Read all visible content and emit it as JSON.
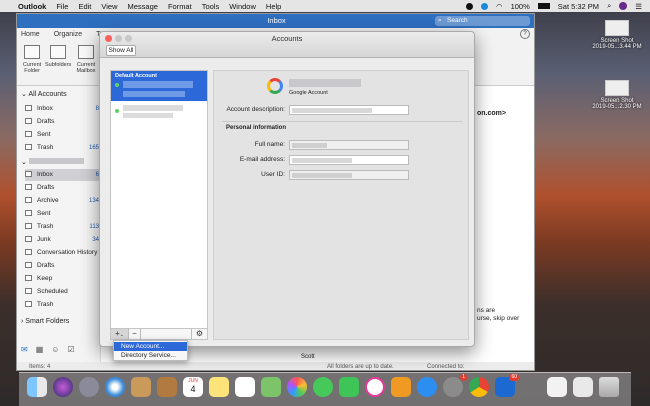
{
  "menubar": {
    "app": "Outlook",
    "items": [
      "File",
      "Edit",
      "View",
      "Message",
      "Format",
      "Tools",
      "Window",
      "Help"
    ],
    "battery": "100%",
    "time": "Sat 5:32 PM"
  },
  "outlook": {
    "title": "Inbox",
    "search_placeholder": "Search",
    "tabs": [
      "Home",
      "Organize",
      "To"
    ],
    "ribbon": [
      "Current Folder",
      "Subfolders",
      "Current Mailbox"
    ],
    "all_accounts": "All Accounts",
    "folders_top": [
      {
        "name": "Inbox",
        "count": "8"
      },
      {
        "name": "Drafts",
        "count": ""
      },
      {
        "name": "Sent",
        "count": ""
      },
      {
        "name": "Trash",
        "count": "165"
      }
    ],
    "folders_acct": [
      {
        "name": "Inbox",
        "count": "6"
      },
      {
        "name": "Drafts",
        "count": ""
      },
      {
        "name": "Archive",
        "count": "134"
      },
      {
        "name": "Sent",
        "count": ""
      },
      {
        "name": "Trash",
        "count": "113"
      },
      {
        "name": "Junk",
        "count": "34"
      },
      {
        "name": "Conversation History",
        "count": ""
      },
      {
        "name": "Drafts",
        "count": ""
      },
      {
        "name": "Keep",
        "count": ""
      },
      {
        "name": "Scheduled",
        "count": ""
      },
      {
        "name": "Trash",
        "count": ""
      }
    ],
    "smart_folders": "Smart Folders",
    "reading_snippet": "on.com>",
    "reading_snippet2": "ns are",
    "reading_snippet3": "urse, skip over",
    "reading_snippet4": "over",
    "sender": "Scott",
    "status_items": "Items: 4",
    "status_sync": "All folders are up to date.",
    "status_conn": "Connected to:"
  },
  "accounts": {
    "title": "Accounts",
    "show_all": "Show All",
    "default_account_label": "Default Account",
    "provider_label": "Google Account",
    "account_description_label": "Account description:",
    "personal_info_header": "Personal information",
    "full_name_label": "Full name:",
    "email_label": "E-mail address:",
    "user_id_label": "User ID:",
    "add_label": "+",
    "remove_label": "−",
    "gear_label": "⚙"
  },
  "add_menu": {
    "items": [
      "New Account...",
      "Directory Service..."
    ]
  },
  "desktop": {
    "icons": [
      {
        "name": "Screen Shot",
        "date": "2019-05...3.44 PM"
      },
      {
        "name": "Screen Shot",
        "date": "2019-05...2.30 PM"
      }
    ]
  },
  "dock": {
    "calendar_month": "JUN",
    "calendar_day": "4",
    "mail_badge": "1",
    "outlook_badge": "60"
  },
  "colors": {
    "accent": "#2c68d8",
    "title_blue": "#2f6fc0",
    "link_blue": "#1e5bb0"
  }
}
